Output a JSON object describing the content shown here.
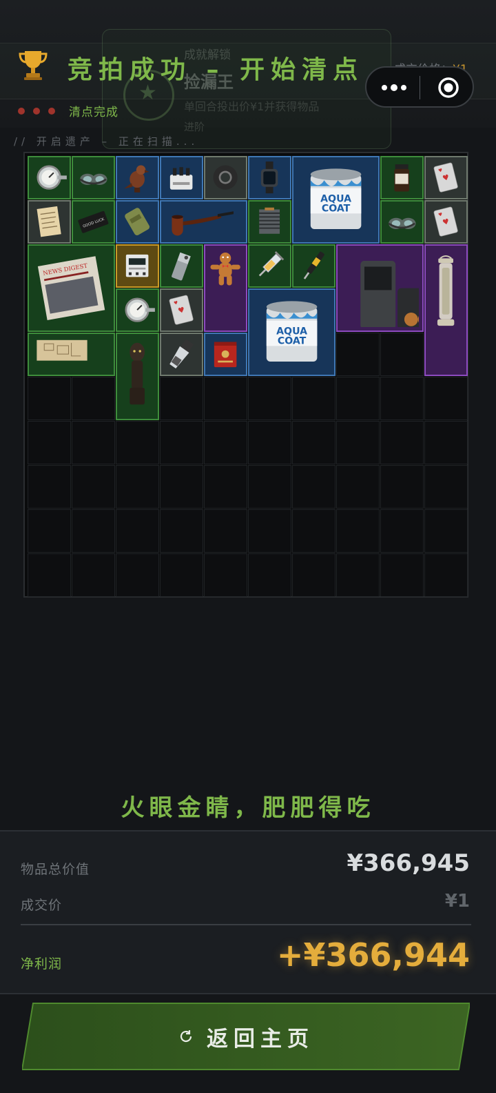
{
  "header": {
    "title": "竞拍成功 – 开始清点",
    "price_label": "成交价格：",
    "price_value": "¥1",
    "status": "清点完成",
    "scan_text": "// 开启遗产 – 正在扫描..."
  },
  "toast": {
    "line1": "成就解锁",
    "line2": "捡漏王",
    "line3": "单回合投出价¥1并获得物品",
    "line4": "进阶"
  },
  "grid": {
    "cols": 10,
    "rows": 10,
    "items": [
      {
        "name": "thermometer",
        "rarity": "green",
        "icon": "thermometer-icon",
        "c": 0,
        "r": 0,
        "w": 1,
        "h": 1
      },
      {
        "name": "goggles",
        "rarity": "green",
        "icon": "goggles-icon",
        "c": 1,
        "r": 0,
        "w": 1,
        "h": 1
      },
      {
        "name": "bird-figurine",
        "rarity": "blue",
        "icon": "bird-figurine-icon",
        "c": 2,
        "r": 0,
        "w": 1,
        "h": 1
      },
      {
        "name": "connector-box",
        "rarity": "blue",
        "icon": "connector-box-icon",
        "c": 3,
        "r": 0,
        "w": 1,
        "h": 1
      },
      {
        "name": "duct-tape",
        "rarity": "gray",
        "icon": "tape-roll-icon",
        "c": 4,
        "r": 0,
        "w": 1,
        "h": 1
      },
      {
        "name": "smartwatch",
        "rarity": "blue",
        "icon": "smartwatch-icon",
        "c": 5,
        "r": 0,
        "w": 1,
        "h": 1
      },
      {
        "name": "paint-can",
        "rarity": "blue",
        "icon": "paint-can-icon",
        "c": 6,
        "r": 0,
        "w": 2,
        "h": 2,
        "label": "AQUA COAT"
      },
      {
        "name": "coffee-jar",
        "rarity": "green",
        "icon": "coffee-jar-icon",
        "c": 8,
        "r": 0,
        "w": 1,
        "h": 1
      },
      {
        "name": "playing-card",
        "rarity": "gray",
        "icon": "playing-card-icon",
        "c": 9,
        "r": 0,
        "w": 1,
        "h": 1
      },
      {
        "name": "paper-note",
        "rarity": "gray",
        "icon": "paper-note-icon",
        "c": 0,
        "r": 1,
        "w": 1,
        "h": 1
      },
      {
        "name": "card-case",
        "rarity": "green",
        "icon": "card-case-icon",
        "c": 1,
        "r": 1,
        "w": 1,
        "h": 1,
        "label": "GOOD LUCK"
      },
      {
        "name": "ration-pack",
        "rarity": "blue",
        "icon": "ration-pack-icon",
        "c": 2,
        "r": 1,
        "w": 1,
        "h": 1
      },
      {
        "name": "tobacco-pipe",
        "rarity": "blue",
        "icon": "pipe-icon",
        "c": 3,
        "r": 1,
        "w": 2,
        "h": 1
      },
      {
        "name": "cpu-cooler",
        "rarity": "green",
        "icon": "cpu-cooler-icon",
        "c": 5,
        "r": 1,
        "w": 1,
        "h": 1
      },
      {
        "name": "goggles-2",
        "rarity": "green",
        "icon": "goggles-icon",
        "c": 8,
        "r": 1,
        "w": 1,
        "h": 1
      },
      {
        "name": "playing-card-2",
        "rarity": "gray",
        "icon": "playing-card-icon",
        "c": 9,
        "r": 1,
        "w": 1,
        "h": 1
      },
      {
        "name": "newspaper",
        "rarity": "green",
        "icon": "newspaper-icon",
        "c": 0,
        "r": 2,
        "w": 2,
        "h": 2,
        "label": "NEWS DIGEST"
      },
      {
        "name": "power-meter",
        "rarity": "gold",
        "icon": "power-meter-icon",
        "c": 2,
        "r": 2,
        "w": 1,
        "h": 1
      },
      {
        "name": "lighter",
        "rarity": "green",
        "icon": "lighter-icon",
        "c": 3,
        "r": 2,
        "w": 1,
        "h": 1
      },
      {
        "name": "gingerbread-man",
        "rarity": "purple",
        "icon": "gingerbread-icon",
        "c": 4,
        "r": 2,
        "w": 1,
        "h": 2
      },
      {
        "name": "syringe",
        "rarity": "green",
        "icon": "syringe-icon",
        "c": 5,
        "r": 2,
        "w": 1,
        "h": 1
      },
      {
        "name": "test-pen",
        "rarity": "green",
        "icon": "test-pen-icon",
        "c": 6,
        "r": 2,
        "w": 1,
        "h": 1
      },
      {
        "name": "coffee-machine",
        "rarity": "purple",
        "icon": "coffee-machine-icon",
        "c": 7,
        "r": 2,
        "w": 2,
        "h": 2
      },
      {
        "name": "lantern",
        "rarity": "purple",
        "icon": "lantern-icon",
        "c": 9,
        "r": 2,
        "w": 1,
        "h": 3
      },
      {
        "name": "thermometer-2",
        "rarity": "green",
        "icon": "thermometer-icon",
        "c": 2,
        "r": 3,
        "w": 1,
        "h": 1
      },
      {
        "name": "playing-card-3",
        "rarity": "gray",
        "icon": "playing-card-icon",
        "c": 3,
        "r": 3,
        "w": 1,
        "h": 1
      },
      {
        "name": "paint-can-2",
        "rarity": "blue",
        "icon": "paint-can-icon",
        "c": 5,
        "r": 3,
        "w": 2,
        "h": 2,
        "label": "AQUA COAT"
      },
      {
        "name": "map-blueprint",
        "rarity": "green",
        "icon": "map-icon",
        "c": 0,
        "r": 4,
        "w": 2,
        "h": 1
      },
      {
        "name": "tribal-statue",
        "rarity": "green",
        "icon": "statue-icon",
        "c": 2,
        "r": 4,
        "w": 1,
        "h": 2
      },
      {
        "name": "pepper-grinder",
        "rarity": "gray",
        "icon": "grinder-icon",
        "c": 3,
        "r": 4,
        "w": 1,
        "h": 1
      },
      {
        "name": "tea-tin",
        "rarity": "blue",
        "icon": "tea-tin-icon",
        "c": 4,
        "r": 4,
        "w": 1,
        "h": 1
      }
    ]
  },
  "tagline": "火眼金睛，肥肥得吃",
  "summary": {
    "total_label": "物品总价值",
    "total_value": "¥366,945",
    "deal_label": "成交价",
    "deal_value": "¥1",
    "profit_label": "净利润",
    "profit_value": "+¥366,944"
  },
  "button": {
    "label": "返回主页",
    "icon": "refresh-icon"
  },
  "colors": {
    "accent_green": "#7fb84a",
    "gold": "#e4ad3c",
    "rarity_green": "#3e8d3c",
    "rarity_blue": "#3f77b4",
    "rarity_gray": "#6f7a6e",
    "rarity_purple": "#8d4bc0",
    "rarity_gold": "#c99b27"
  }
}
